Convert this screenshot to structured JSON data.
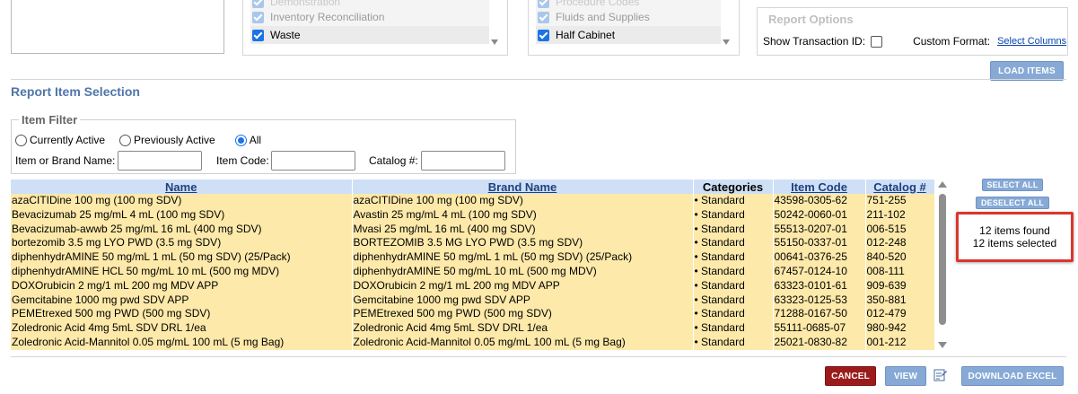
{
  "type_list": {
    "items": [
      {
        "label": "Demonstration",
        "checked": true,
        "active": false
      },
      {
        "label": "Inventory Reconciliation",
        "checked": true,
        "active": false
      },
      {
        "label": "Waste",
        "checked": true,
        "active": true
      }
    ]
  },
  "location_list": {
    "items": [
      {
        "label": "Procedure Codes",
        "checked": true,
        "active": false
      },
      {
        "label": "Fluids and Supplies",
        "checked": true,
        "active": false
      },
      {
        "label": "Half Cabinet",
        "checked": true,
        "active": true
      }
    ]
  },
  "report_options": {
    "title": "Report Options",
    "show_transaction_label": "Show Transaction ID:",
    "custom_format_label": "Custom Format:",
    "select_columns_link": "Select Columns"
  },
  "load_items_label": "LOAD ITEMS",
  "report_item_selection_title": "Report Item Selection",
  "item_filter": {
    "title": "Item Filter",
    "radios": [
      "Currently Active",
      "Previously Active",
      "All"
    ],
    "selected": "All",
    "item_or_brand_label": "Item or Brand Name:",
    "item_code_label": "Item Code:",
    "catalog_label": "Catalog #:",
    "item_or_brand_value": "",
    "item_code_value": "",
    "catalog_value": ""
  },
  "table": {
    "columns": [
      "Name",
      "Brand Name",
      "Categories",
      "Item Code",
      "Catalog #"
    ],
    "rows": [
      [
        "azaCITIDine 100 mg (100 mg SDV)",
        "azaCITIDine 100 mg (100 mg SDV)",
        "• Standard",
        "43598-0305-62",
        "751-255"
      ],
      [
        "Bevacizumab 25 mg/mL 4 mL (100 mg SDV)",
        "Avastin 25 mg/mL 4 mL (100 mg SDV)",
        "• Standard",
        "50242-0060-01",
        "211-102"
      ],
      [
        "Bevacizumab-awwb 25 mg/mL 16 mL (400 mg SDV)",
        "Mvasi 25 mg/mL 16 mL (400 mg SDV)",
        "• Standard",
        "55513-0207-01",
        "006-515"
      ],
      [
        "bortezomib 3.5 mg LYO PWD (3.5 mg SDV)",
        "BORTEZOMIB 3.5 MG LYO PWD (3.5 mg SDV)",
        "• Standard",
        "55150-0337-01",
        "012-248"
      ],
      [
        "diphenhydrAMINE 50 mg/mL 1 mL (50 mg SDV) (25/Pack)",
        "diphenhydrAMINE 50 mg/mL 1 mL (50 mg SDV) (25/Pack)",
        "• Standard",
        "00641-0376-25",
        "840-520"
      ],
      [
        "diphenhydrAMINE HCL 50 mg/mL 10 mL (500 mg MDV)",
        "diphenhydrAMINE 50 mg/mL 10 mL (500 mg MDV)",
        "• Standard",
        "67457-0124-10",
        "008-111"
      ],
      [
        "DOXOrubicin 2 mg/1 mL 200 mg MDV APP",
        "DOXOrubicin 2 mg/1 mL 200 mg MDV APP",
        "• Standard",
        "63323-0101-61",
        "909-639"
      ],
      [
        "Gemcitabine 1000 mg pwd SDV APP",
        "Gemcitabine 1000 mg pwd SDV APP",
        "• Standard",
        "63323-0125-53",
        "350-881"
      ],
      [
        "PEMEtrexed 500 mg PWD (500 mg SDV)",
        "PEMEtrexed 500 mg PWD (500 mg SDV)",
        "• Standard",
        "71288-0167-50",
        "012-479"
      ],
      [
        "Zoledronic Acid 4mg 5mL SDV DRL 1/ea",
        "Zoledronic Acid 4mg 5mL SDV DRL 1/ea",
        "• Standard",
        "55111-0685-07",
        "980-942"
      ],
      [
        "Zoledronic Acid-Mannitol 0.05 mg/mL 100 mL (5 mg Bag)",
        "Zoledronic Acid-Mannitol 0.05 mg/mL 100 mL (5 mg Bag)",
        "• Standard",
        "25021-0830-82",
        "001-212"
      ]
    ]
  },
  "select_all_label": "SELECT ALL",
  "deselect_all_label": "DESELECT ALL",
  "counts": {
    "found": "12 items found",
    "selected": "12 items selected"
  },
  "footer": {
    "cancel_label": "CANCEL",
    "view_label": "VIEW",
    "download_excel_label": "DOWNLOAD EXCEL"
  },
  "colors": {
    "accent_blue": "#86a9d6",
    "cancel_red": "#9b1b1b",
    "row_yellow": "#fde9a9",
    "header_blue": "#cfe0f6",
    "highlight_red": "#d9362f"
  }
}
